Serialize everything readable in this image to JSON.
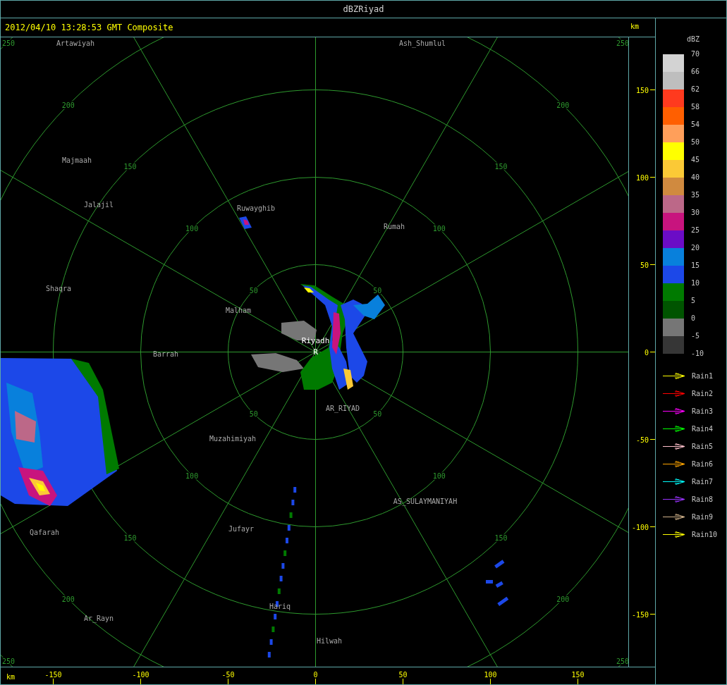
{
  "window": {
    "title": "dBZRiyad"
  },
  "header": {
    "timestamp": "2012/04/10 13:28:53 GMT Composite"
  },
  "radar": {
    "rings": [
      {
        "labels": [
          "50",
          "50",
          "50",
          "50"
        ]
      },
      {
        "labels": [
          "100",
          "100",
          "100",
          "100"
        ]
      },
      {
        "labels": [
          "150",
          "150",
          "150",
          "150"
        ]
      },
      {
        "labels": [
          "200",
          "200",
          "200",
          "200"
        ]
      },
      {
        "labels": [
          "250",
          "250",
          "250",
          "250"
        ]
      }
    ],
    "towns": [
      {
        "name": "Artawiyah"
      },
      {
        "name": "Ash_Shumlul"
      },
      {
        "name": "Majmaah"
      },
      {
        "name": "Jalajil"
      },
      {
        "name": "Ruwayghib"
      },
      {
        "name": "Rumah"
      },
      {
        "name": "Shaqra"
      },
      {
        "name": "Malham"
      },
      {
        "name": "Barrah"
      },
      {
        "name": "AR_RIYAD"
      },
      {
        "name": "Muzahimiyah"
      },
      {
        "name": "AS_SULAYMANIYAH"
      },
      {
        "name": "Qafarah"
      },
      {
        "name": "Jufayr"
      },
      {
        "name": "Hariq"
      },
      {
        "name": "Ar_Rayn"
      },
      {
        "name": "Hilwah"
      }
    ],
    "site": {
      "name": "Riyadh",
      "marker": "R"
    }
  },
  "y_axis": {
    "unit": "km",
    "ticks": [
      "150",
      "100",
      "50",
      "0",
      "-50",
      "-100",
      "-150"
    ]
  },
  "x_axis": {
    "unit": "km",
    "ticks": [
      "-150",
      "-100",
      "-50",
      "0",
      "50",
      "100",
      "150"
    ]
  },
  "legend": {
    "title": "dBZ",
    "bins": [
      {
        "label": "70",
        "color": "#d3d3d3"
      },
      {
        "label": "66",
        "color": "#bebebe"
      },
      {
        "label": "62",
        "color": "#ff3a1e"
      },
      {
        "label": "58",
        "color": "#ff5f00"
      },
      {
        "label": "54",
        "color": "#ff9f5a"
      },
      {
        "label": "50",
        "color": "#ffff00"
      },
      {
        "label": "45",
        "color": "#fbc936"
      },
      {
        "label": "40",
        "color": "#d08a3f"
      },
      {
        "label": "35",
        "color": "#bc6888"
      },
      {
        "label": "30",
        "color": "#c8147e"
      },
      {
        "label": "25",
        "color": "#6b0cc6"
      },
      {
        "label": "20",
        "color": "#0880dc"
      },
      {
        "label": "15",
        "color": "#1c48e8"
      },
      {
        "label": "10",
        "color": "#007a00"
      },
      {
        "label": "5",
        "color": "#005400"
      },
      {
        "label": "0",
        "color": "#767676"
      },
      {
        "label": "-5",
        "color": "#363636"
      }
    ],
    "bottom_label": "-10",
    "tracks": [
      {
        "label": "Rain1",
        "color": "#ffff00"
      },
      {
        "label": "Rain2",
        "color": "#ff0000"
      },
      {
        "label": "Rain3",
        "color": "#ff00ff"
      },
      {
        "label": "Rain4",
        "color": "#00ff00"
      },
      {
        "label": "Rain5",
        "color": "#ffc0cb"
      },
      {
        "label": "Rain6",
        "color": "#ffa500"
      },
      {
        "label": "Rain7",
        "color": "#00ffff"
      },
      {
        "label": "Rain8",
        "color": "#9933ff"
      },
      {
        "label": "Rain9",
        "color": "#d2b48c"
      },
      {
        "label": "Rain10",
        "color": "#ffff00"
      }
    ]
  }
}
